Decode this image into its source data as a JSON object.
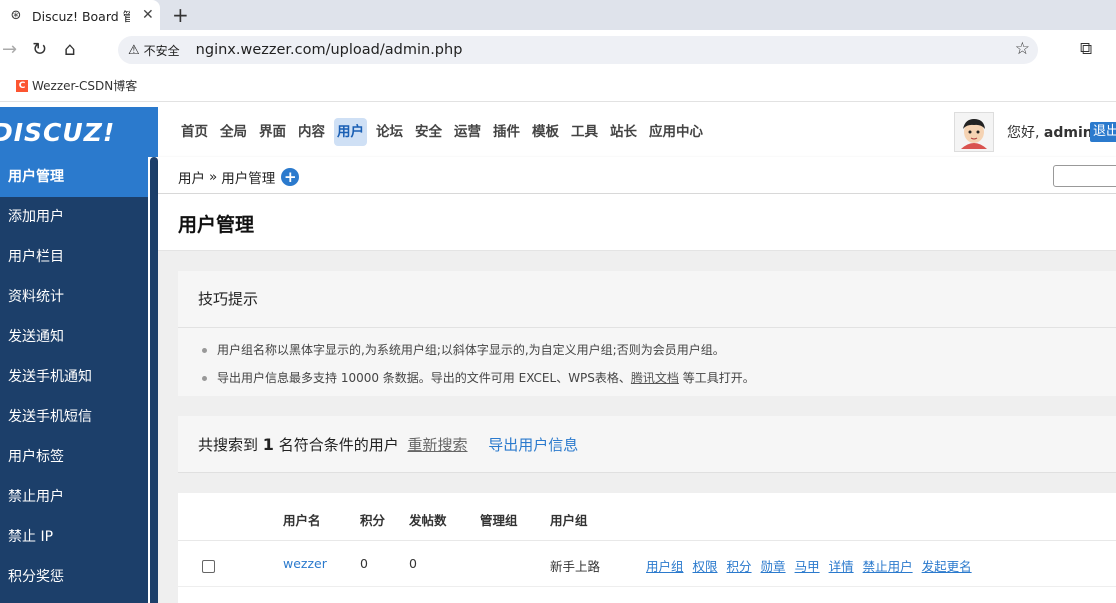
{
  "browser": {
    "tab_title": "Discuz! Board 管理中心",
    "new_tab": "+",
    "close": "✕",
    "insecure_label": "不安全",
    "url": "nginx.wezzer.com/upload/admin.php",
    "bookmark": "Wezzer-CSDN博客",
    "bookmark_icon": "C"
  },
  "logo": "DISCUZ!",
  "topnav": [
    "首页",
    "全局",
    "界面",
    "内容",
    "用户",
    "论坛",
    "安全",
    "运营",
    "插件",
    "模板",
    "工具",
    "站长",
    "应用中心"
  ],
  "topnav_active": "用户",
  "user": {
    "greeting": "您好,",
    "name": "admin",
    "logout": "退出"
  },
  "sidebar": [
    "用户管理",
    "添加用户",
    "用户栏目",
    "资料统计",
    "发送通知",
    "发送手机通知",
    "发送手机短信",
    "用户标签",
    "禁止用户",
    "禁止 IP",
    "积分奖惩"
  ],
  "breadcrumb": {
    "parent": "用户",
    "separator": "»",
    "current": "用户管理",
    "plus": "+"
  },
  "page_title": "用户管理",
  "tips": {
    "heading": "技巧提示",
    "line1": "用户组名称以黑体字显示的,为系统用户组;以斜体字显示的,为自定义用户组;否则为会员用户组。",
    "line2_pre": "导出用户信息最多支持 10000 条数据。导出的文件可用 EXCEL、WPS表格、",
    "line2_link": "腾讯文档",
    "line2_post": " 等工具打开。"
  },
  "result": {
    "pre": "共搜索到 ",
    "count": "1",
    "post": " 名符合条件的用户",
    "research": "重新搜索",
    "export": "导出用户信息"
  },
  "table": {
    "headers": [
      "用户名",
      "积分",
      "发帖数",
      "管理组",
      "用户组"
    ],
    "rows": [
      {
        "username": "wezzer",
        "credits": "0",
        "posts": "0",
        "admin_group": "",
        "user_group": "新手上路"
      }
    ],
    "actions": [
      "用户组",
      "权限",
      "积分",
      "勋章",
      "马甲",
      "详情",
      "禁止用户",
      "发起更名"
    ]
  }
}
